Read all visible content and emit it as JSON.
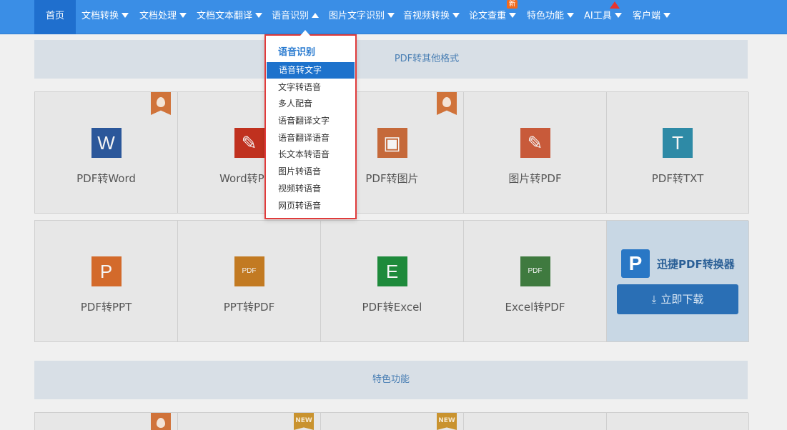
{
  "nav": {
    "items": [
      {
        "label": "首页",
        "dropdown": false
      },
      {
        "label": "文档转换",
        "dropdown": true
      },
      {
        "label": "文档处理",
        "dropdown": true
      },
      {
        "label": "文档文本翻译",
        "dropdown": true
      },
      {
        "label": "语音识别",
        "dropdown": true,
        "open": true
      },
      {
        "label": "图片文字识别",
        "dropdown": true
      },
      {
        "label": "音视频转换",
        "dropdown": true
      },
      {
        "label": "论文查重",
        "dropdown": true
      },
      {
        "label": "特色功能",
        "dropdown": true
      },
      {
        "label": "AI工具",
        "dropdown": true
      },
      {
        "label": "客户端",
        "dropdown": true
      }
    ],
    "new_badge": "新"
  },
  "section_bar_1": "PDF转其他格式",
  "row1": [
    {
      "label": "PDF转Word",
      "icon": "word-icon",
      "glyph": "W",
      "color": "#2b579a",
      "hot": true
    },
    {
      "label": "Word转PDF",
      "icon": "pdf-icon",
      "glyph": "✎",
      "color": "#c0311f",
      "hot": false
    },
    {
      "label": "PDF转图片",
      "icon": "image-icon",
      "glyph": "▣",
      "color": "#c5693a",
      "hot": true
    },
    {
      "label": "图片转PDF",
      "icon": "pdf-icon",
      "glyph": "✎",
      "color": "#c85a3a",
      "hot": false
    },
    {
      "label": "PDF转TXT",
      "icon": "txt-icon",
      "glyph": "T",
      "color": "#2e8aa6",
      "hot": false
    }
  ],
  "row2": [
    {
      "label": "PDF转PPT",
      "icon": "ppt-icon",
      "glyph": "P",
      "color": "#d36a2b"
    },
    {
      "label": "PPT转PDF",
      "icon": "ppt-pdf-icon",
      "glyph": "PDF",
      "color": "#c27a22"
    },
    {
      "label": "PDF转Excel",
      "icon": "excel-icon",
      "glyph": "E",
      "color": "#1e8a3b"
    },
    {
      "label": "Excel转PDF",
      "icon": "excel-pdf-icon",
      "glyph": "PDF",
      "color": "#3f7a3f"
    }
  ],
  "promo": {
    "logo_glyph": "P",
    "title": "迅捷PDF转换器",
    "download_label": "立即下载"
  },
  "section_bar_2": "特色功能",
  "row3_tags": [
    {
      "type": "hot",
      "text": ""
    },
    {
      "type": "new",
      "text": "NEW"
    },
    {
      "type": "new",
      "text": "NEW"
    }
  ],
  "dropdown": {
    "title": "语音识别",
    "options": [
      "语音转文字",
      "文字转语音",
      "多人配音",
      "语音翻译文字",
      "语音翻译语音",
      "长文本转语音",
      "图片转语音",
      "视频转语音",
      "网页转语音"
    ],
    "active_index": 0
  }
}
